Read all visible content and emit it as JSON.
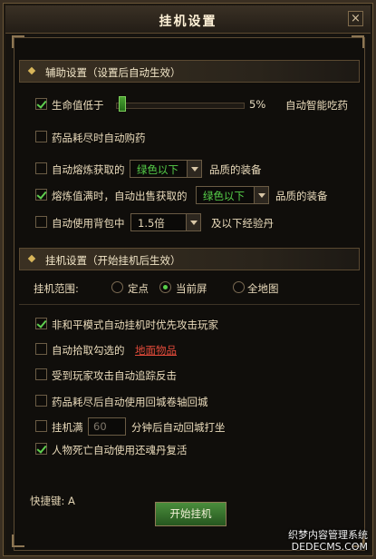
{
  "window": {
    "title": "挂机设置",
    "close_label": "×"
  },
  "assist": {
    "header": "辅助设置（设置后自动生效）",
    "hp_label": "生命值低于",
    "hp_percent": 5,
    "hp_percent_text": "5%",
    "hp_action": "自动智能吃药",
    "potion_buy": "药品耗尽时自动购药",
    "smelt_prefix": "自动熔炼获取的",
    "smelt_dropdown": "绿色以下",
    "smelt_suffix": "品质的装备",
    "sell_prefix": "熔炼值满时，自动出售获取的",
    "sell_dropdown": "绿色以下",
    "sell_suffix": "品质的装备",
    "bag_prefix": "自动使用背包中",
    "bag_dropdown": "1.5倍",
    "bag_suffix": "及以下经验丹"
  },
  "idle": {
    "header": "挂机设置（开始挂机后生效）",
    "range_label": "挂机范围:",
    "range_options": [
      "定点",
      "当前屏",
      "全地图"
    ],
    "range_selected": "当前屏",
    "opt_priority_attack": "非和平模式自动挂机时优先攻击玩家",
    "opt_pickup_prefix": "自动拾取勾选的",
    "opt_pickup_link": "地面物品",
    "opt_counterattack": "受到玩家攻击自动追踪反击",
    "opt_return_scroll": "药品耗尽后自动使用回城卷轴回城",
    "opt_full_prefix": "挂机满",
    "opt_full_minutes": "60",
    "opt_full_suffix": "分钟后自动回城打坐",
    "opt_revive": "人物死亡自动使用还魂丹复活"
  },
  "footer": {
    "hotkey_label": "快捷键: A",
    "start_button": "开始挂机"
  },
  "watermark": {
    "line1": "织梦内容管理系统",
    "line2": "DEDECMS.COM"
  },
  "colors": {
    "accent_green": "#57d14a",
    "link_red": "#e14a3a",
    "frame_gold": "#8d7654"
  },
  "checks": {
    "hp": true,
    "potion_buy": false,
    "smelt": false,
    "sell": true,
    "bag": false,
    "priority_attack": true,
    "pickup": false,
    "counterattack": false,
    "return_scroll": false,
    "full": false,
    "revive": true
  }
}
